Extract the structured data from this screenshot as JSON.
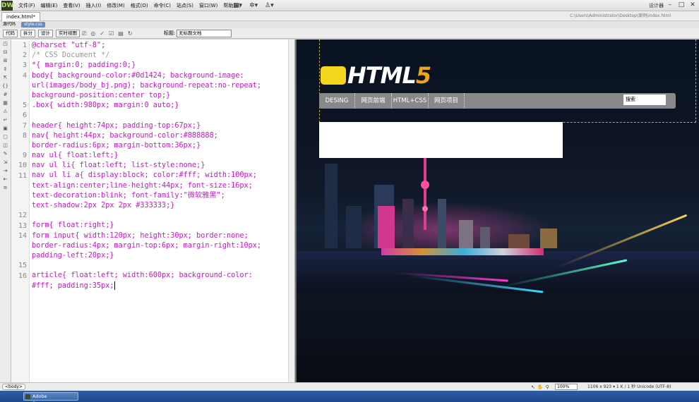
{
  "app": {
    "logo": "DW",
    "title": "Adobe Dreamweaver"
  },
  "menu": [
    "文件(F)",
    "编辑(E)",
    "查看(V)",
    "插入(I)",
    "修改(M)",
    "格式(O)",
    "命令(C)",
    "站点(S)",
    "窗口(W)",
    "帮助(H)"
  ],
  "workspace": "设计器",
  "tab": {
    "label": "index.html*",
    "path": "C:\\Users\\Administrator\\Desktop\\案例\\index.html"
  },
  "related_files": {
    "source": "源代码",
    "css": "style.css"
  },
  "view_buttons": [
    "代码",
    "拆分",
    "设计",
    "实时视图"
  ],
  "title_label": "标题:",
  "title_value": "无标题文档",
  "code_lines": [
    {
      "n": "1",
      "text": "@charset \"utf-8\";"
    },
    {
      "n": "2",
      "text": "/* CSS Document */"
    },
    {
      "n": "3",
      "text": "*{ margin:0; padding:0;}"
    },
    {
      "n": "4",
      "text": "body{ background-color:#0d1424; background-image:"
    },
    {
      "n": "",
      "text": "url(images/body_bj.png); background-repeat:no-repeat;"
    },
    {
      "n": "",
      "text": "background-position:center top;}"
    },
    {
      "n": "5",
      "text": ".box{ width:980px; margin:0 auto;}"
    },
    {
      "n": "6",
      "text": ""
    },
    {
      "n": "7",
      "text": "header{ height:74px; padding-top:67px;}"
    },
    {
      "n": "8",
      "text": "nav{ height:44px; background-color:#888888;"
    },
    {
      "n": "",
      "text": "border-radius:6px; margin-bottom:36px;}"
    },
    {
      "n": "9",
      "text": "nav ul{ float:left;}"
    },
    {
      "n": "10",
      "text": "nav ul li{ float:left; list-style:none;}"
    },
    {
      "n": "11",
      "text": "nav ul li a{ display:block; color:#fff; width:100px;"
    },
    {
      "n": "",
      "text": "text-align:center;line-height:44px; font-size:16px;"
    },
    {
      "n": "",
      "text": "text-decoration:blink; font-family:\"微软雅黑\";"
    },
    {
      "n": "",
      "text": "text-shadow:2px 2px 2px #333333;}"
    },
    {
      "n": "12",
      "text": ""
    },
    {
      "n": "13",
      "text": "form{ float:right;}"
    },
    {
      "n": "14",
      "text": "form input{ width:120px; height:30px; border:none;"
    },
    {
      "n": "",
      "text": "border-radius:4px; margin-top:6px; margin-right:10px;"
    },
    {
      "n": "",
      "text": "padding-left:20px;}"
    },
    {
      "n": "15",
      "text": ""
    },
    {
      "n": "16",
      "text": "article{ float:left; width:600px; background-color:"
    },
    {
      "n": "",
      "text": "#fff; padding:35px;"
    }
  ],
  "design": {
    "logo_text": "HTML",
    "logo_five": "5",
    "nav": [
      "DESING",
      "网页前端",
      "HTML+CSS",
      "网页项目"
    ],
    "search_value": "搜索"
  },
  "status": {
    "tag": "<body>",
    "zoom": "100%",
    "info": "1106 x 923 ▾ 1 K / 1 秒  Unicode (UTF-8)"
  },
  "taskbar": {
    "item": "Adobe Dreamweav..."
  }
}
